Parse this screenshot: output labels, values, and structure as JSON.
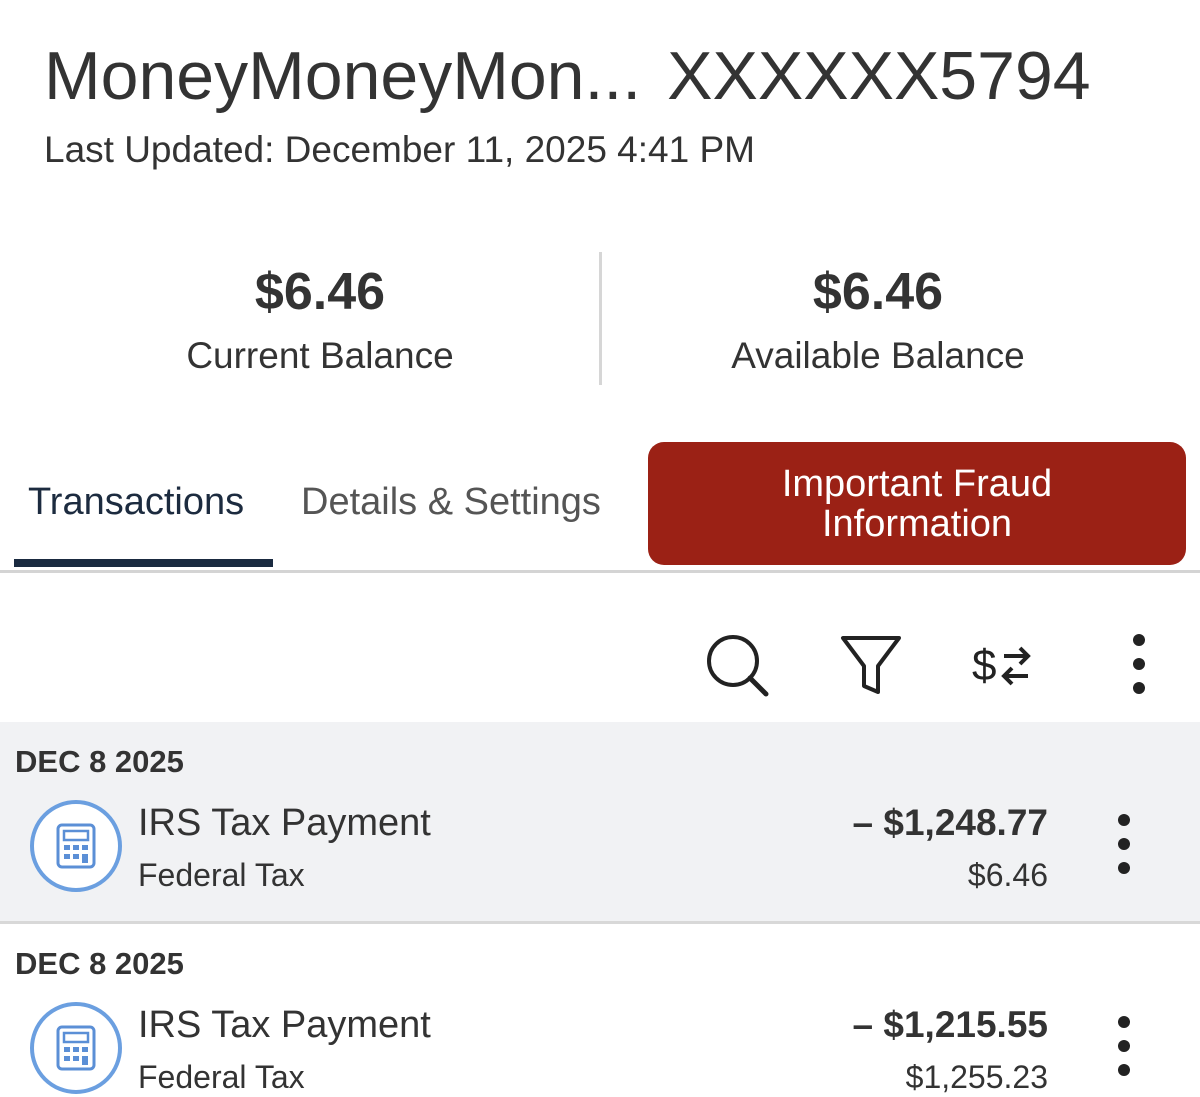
{
  "header": {
    "account_name": "MoneyMoneyMon...",
    "account_number": "XXXXXX5794",
    "last_updated": "Last Updated: December 11, 2025 4:41 PM"
  },
  "balances": {
    "current": {
      "amount": "$6.46",
      "label": "Current Balance"
    },
    "available": {
      "amount": "$6.46",
      "label": "Available Balance"
    }
  },
  "tabs": {
    "transactions": "Transactions",
    "details": "Details & Settings",
    "active": "Transactions"
  },
  "fraud_button": {
    "label": "Important Fraud Information",
    "color": "#9b2115"
  },
  "toolbar": {
    "icons": [
      "search-icon",
      "filter-icon",
      "dollar-transfer-icon",
      "more-vertical-icon"
    ]
  },
  "transactions": [
    {
      "date": "DEC 8 2025",
      "icon": "calculator-icon",
      "name": "IRS Tax Payment",
      "category": "Federal Tax",
      "amount": "– $1,248.77",
      "running_balance": "$6.46"
    },
    {
      "date": "DEC 8 2025",
      "icon": "calculator-icon",
      "name": "IRS Tax Payment",
      "category": "Federal Tax",
      "amount": "– $1,215.55",
      "running_balance": "$1,255.23"
    }
  ],
  "colors": {
    "accent_navy": "#1a2a40",
    "icon_blue": "#6b9fe0",
    "row_background": "#f1f2f4"
  }
}
